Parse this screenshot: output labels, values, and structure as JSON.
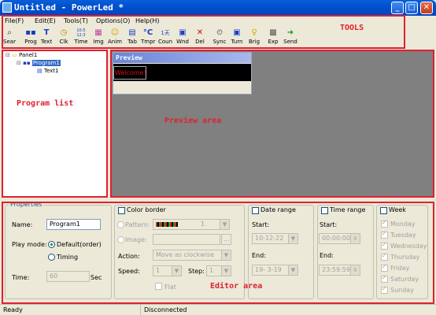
{
  "window": {
    "title": "Untitled - PowerLed *"
  },
  "menu": [
    "File(F)",
    "Edit(E)",
    "Tools(T)",
    "Options(O)",
    "Help(H)"
  ],
  "toolbar": {
    "buttons": [
      {
        "label": "Sear",
        "icon": "search-icon"
      },
      {
        "label": "Prog",
        "icon": "program-icon"
      },
      {
        "label": "Text",
        "icon": "text-icon"
      },
      {
        "label": "Clk",
        "icon": "clock-icon"
      },
      {
        "label": "Time",
        "icon": "time-icon"
      },
      {
        "label": "Img",
        "icon": "image-icon"
      },
      {
        "label": "Anim",
        "icon": "animation-icon"
      },
      {
        "label": "Tab",
        "icon": "table-icon"
      },
      {
        "label": "Tmpr",
        "icon": "temperature-icon"
      },
      {
        "label": "Coun",
        "icon": "counter-icon"
      },
      {
        "label": "Wnd",
        "icon": "window-icon"
      },
      {
        "label": "Del",
        "icon": "delete-icon"
      },
      {
        "label": "Sync",
        "icon": "sync-icon"
      },
      {
        "label": "Turn",
        "icon": "turn-icon"
      },
      {
        "label": "Brig",
        "icon": "brightness-icon"
      },
      {
        "label": "Exp",
        "icon": "export-icon"
      },
      {
        "label": "Send",
        "icon": "send-icon"
      }
    ],
    "clock_glyph": "10:5\n12:3",
    "tmpr_glyph": "°C"
  },
  "annotations": {
    "tools": "TOOLS",
    "program_list": "Program list",
    "preview_area": "Preview area",
    "editor_area": "Editor area"
  },
  "tree": {
    "panel": "Panel1",
    "program": "Program1",
    "text": "Text1"
  },
  "preview": {
    "title": "Preview",
    "content": "Welcome!"
  },
  "properties": {
    "legend": "Properties",
    "name_label": "Name:",
    "name_value": "Program1",
    "playmode_label": "Play mode:",
    "playmode_options": [
      "Default(order)",
      "Timing"
    ],
    "playmode_selected": "Default(order)",
    "time_label": "Time:",
    "time_value": "60",
    "time_unit": "Sec"
  },
  "color_border": {
    "legend": "Color border",
    "pattern_label": "Pattern:",
    "pattern_value": "1",
    "image_label": "Image:",
    "image_browse": "...",
    "action_label": "Action:",
    "action_value": "Move as clockwise",
    "speed_label": "Speed:",
    "speed_value": "1",
    "step_label": "Step:",
    "step_value": "1",
    "flat_label": "Flat"
  },
  "date_range": {
    "legend": "Date range",
    "start_label": "Start:",
    "start_value": "10-12-22",
    "end_label": "End:",
    "end_value": "19- 3-19"
  },
  "time_range": {
    "legend": "Time range",
    "start_label": "Start:",
    "start_value": "00:00:00",
    "end_label": "End:",
    "end_value": "23:59:59"
  },
  "week": {
    "legend": "Week",
    "days": [
      "Monday",
      "Tuesday",
      "Wednesday",
      "Thursday",
      "Friday",
      "Saturday",
      "Sunday"
    ]
  },
  "status": {
    "left": "Ready",
    "middle": "Disconnected"
  },
  "colors": {
    "annotation": "#e02030",
    "titlebar": "#0054e3",
    "preview_bg": "#808080"
  }
}
